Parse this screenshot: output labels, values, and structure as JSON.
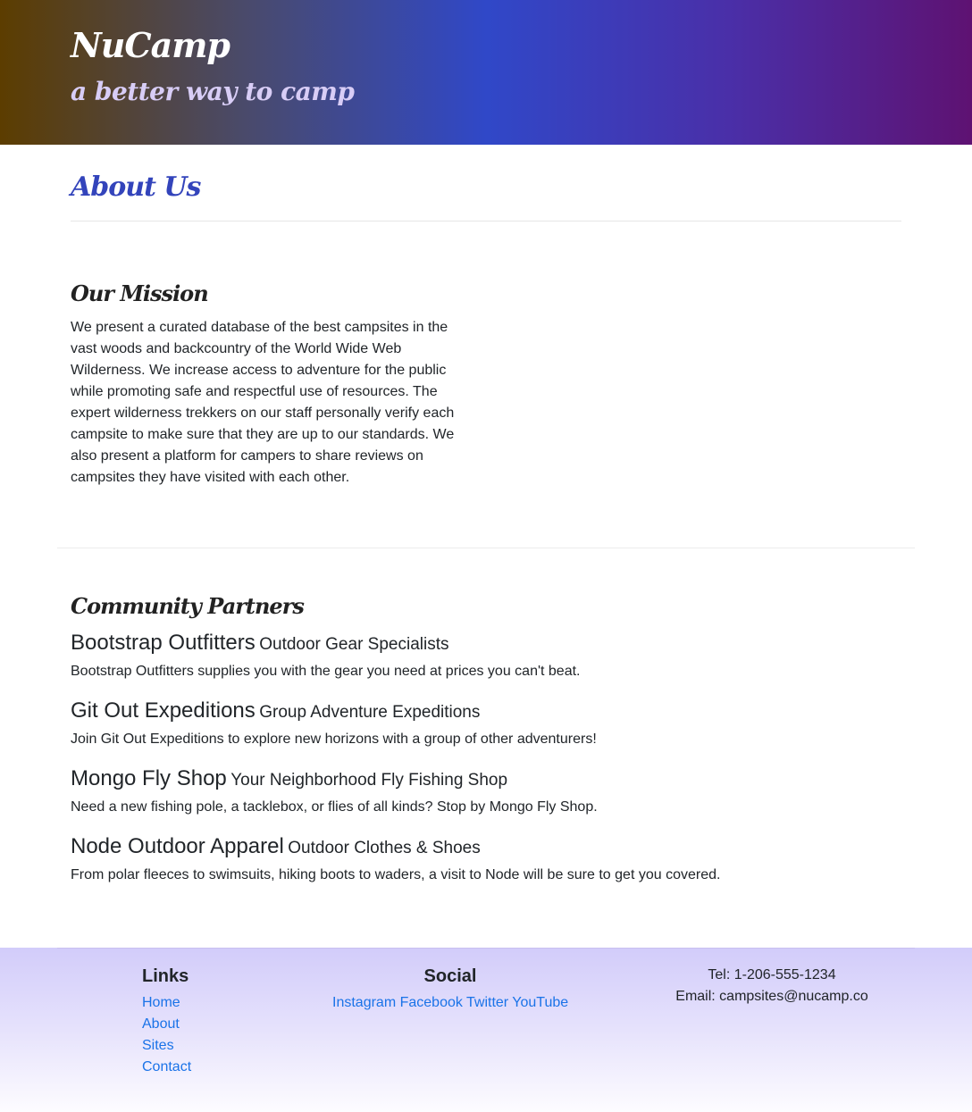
{
  "header": {
    "brand": "NuCamp",
    "tagline": "a better way to camp"
  },
  "main": {
    "title": "About Us",
    "mission": {
      "title": "Our Mission",
      "text": "We present a curated database of the best campsites in the vast woods and backcountry of the World Wide Web Wilderness. We increase access to adventure for the public while promoting safe and respectful use of resources. The expert wilderness trekkers on our staff personally verify each campsite to make sure that they are up to our standards. We also present a platform for campers to share reviews on campsites they have visited with each other."
    },
    "partners": {
      "title": "Community Partners",
      "items": [
        {
          "name": "Bootstrap Outfitters",
          "subtitle": "Outdoor Gear Specialists",
          "description": "Bootstrap Outfitters supplies you with the gear you need at prices you can't beat."
        },
        {
          "name": "Git Out Expeditions",
          "subtitle": "Group Adventure Expeditions",
          "description": "Join Git Out Expeditions to explore new horizons with a group of other adventurers!"
        },
        {
          "name": "Mongo Fly Shop",
          "subtitle": "Your Neighborhood Fly Fishing Shop",
          "description": "Need a new fishing pole, a tacklebox, or flies of all kinds? Stop by Mongo Fly Shop."
        },
        {
          "name": "Node Outdoor Apparel",
          "subtitle": "Outdoor Clothes & Shoes",
          "description": "From polar fleeces to swimsuits, hiking boots to waders, a visit to Node will be sure to get you covered."
        }
      ]
    }
  },
  "footer": {
    "links": {
      "title": "Links",
      "items": [
        "Home",
        "About",
        "Sites",
        "Contact"
      ]
    },
    "social": {
      "title": "Social",
      "items": [
        "Instagram",
        "Facebook",
        "Twitter",
        "YouTube"
      ]
    },
    "contact": {
      "phone": "Tel: 1-206-555-1234",
      "email": "Email: campsites@nucamp.co"
    }
  },
  "colors": {
    "accent": "#3344bb",
    "link": "#1a73e8",
    "tagline": "#d8cdf6"
  }
}
